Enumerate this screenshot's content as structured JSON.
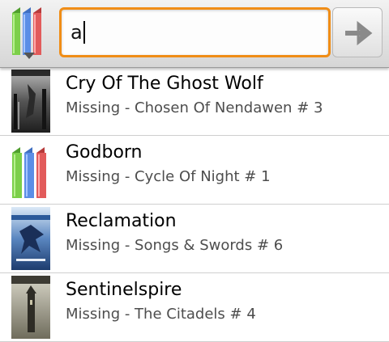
{
  "search": {
    "query": "a"
  },
  "results": [
    {
      "title": "Cry Of The Ghost Wolf",
      "subtitle": "Missing - Chosen Of Nendawen # 3",
      "cover": "dark-forest-cover"
    },
    {
      "title": "Godborn",
      "subtitle": "Missing - Cycle Of Night # 1",
      "cover": "placeholder-books-icon"
    },
    {
      "title": "Reclamation",
      "subtitle": "Missing - Songs & Swords # 6",
      "cover": "blue-dragon-cover",
      "cover_text": "RECLAMATION"
    },
    {
      "title": "Sentinelspire",
      "subtitle": "Missing - The Citadels # 4",
      "cover": "tower-cover"
    }
  ],
  "colors": {
    "focus_border": "#f08d16",
    "book_green": "#7ccf4a",
    "book_blue": "#5b8ee6",
    "book_red": "#e25b5b"
  }
}
